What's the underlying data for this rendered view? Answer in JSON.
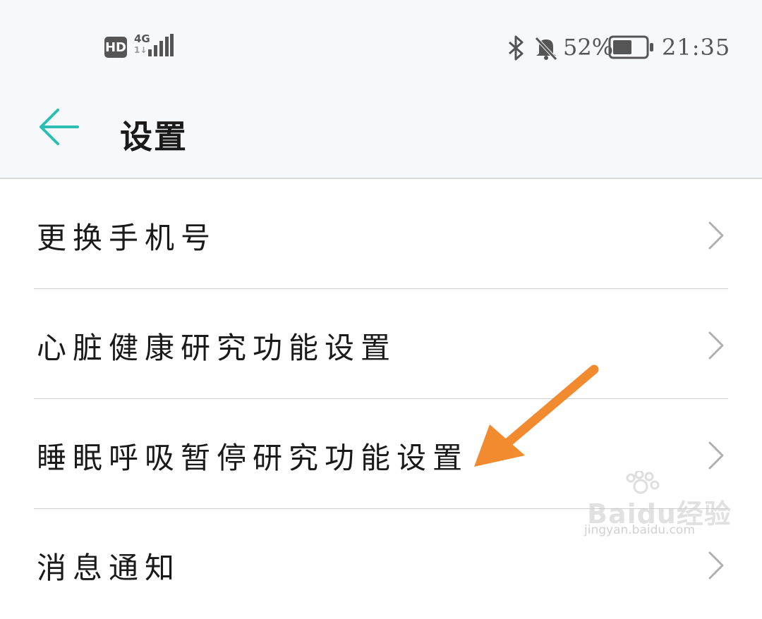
{
  "status_bar": {
    "hd_badge": "HD",
    "network": "4G",
    "network_sub": "1↓",
    "battery_percent": "52%",
    "time": "21:35"
  },
  "header": {
    "title": "设置",
    "back_icon": "arrow-left-icon",
    "accent_color": "#2bbfb3"
  },
  "settings_list": [
    {
      "label": "更换手机号",
      "icon": "chevron-right-icon"
    },
    {
      "label": "心脏健康研究功能设置",
      "icon": "chevron-right-icon"
    },
    {
      "label": "睡眠呼吸暂停研究功能设置",
      "icon": "chevron-right-icon"
    },
    {
      "label": "消息通知",
      "icon": "chevron-right-icon"
    }
  ],
  "overlay": {
    "arrow_color": "#f28a30"
  },
  "watermark": {
    "text": "Baidu经验",
    "url": "jingyan.baidu.com"
  }
}
